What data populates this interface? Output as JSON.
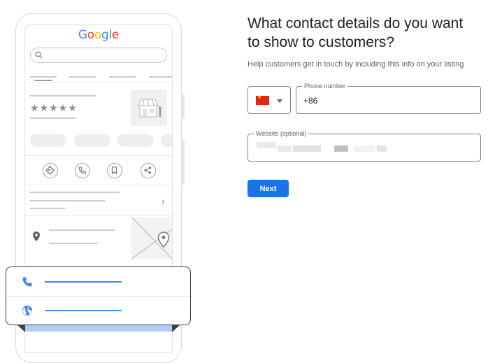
{
  "illustration": {
    "logo": {
      "letters": [
        "G",
        "o",
        "o",
        "g",
        "l",
        "e"
      ],
      "colors": [
        "#4285f4",
        "#ea4335",
        "#fbbc05",
        "#4285f4",
        "#34a853",
        "#ea4335"
      ]
    },
    "rating_stars": "★★★★★",
    "icons": [
      "search-icon",
      "directions-icon",
      "phone-icon",
      "bookmark-icon",
      "share-icon",
      "location-pin-icon",
      "chevron-right-icon",
      "store-icon",
      "map-pin-icon"
    ],
    "card_icons": [
      "phone-icon",
      "globe-icon"
    ],
    "accent": "#4285f4"
  },
  "form": {
    "title": "What contact details do you want to show to customers?",
    "subtitle": "Help customers get in touch by including this info on your listing",
    "country_flag": "china-flag-icon",
    "phone": {
      "label": "Phone number",
      "value": "+86"
    },
    "website": {
      "label": "Website (optional)",
      "value": ""
    },
    "next_label": "Next",
    "primary_color": "#1a73e8"
  }
}
